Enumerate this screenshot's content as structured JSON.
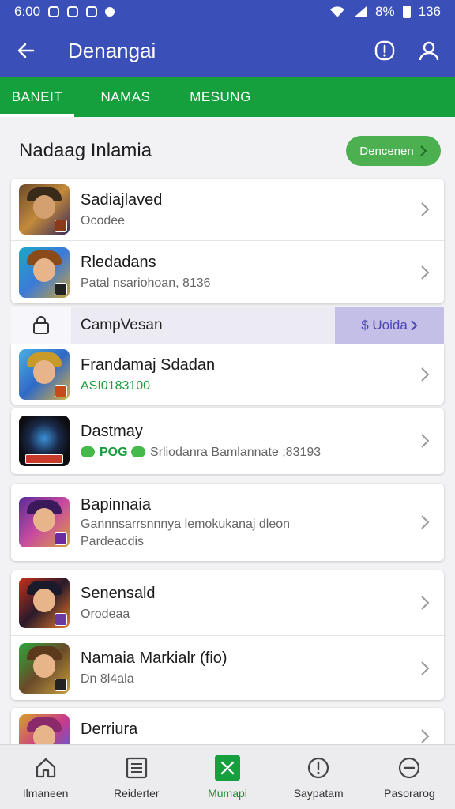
{
  "status": {
    "time": "6:00",
    "battery_text": "8%",
    "right_num": "136"
  },
  "header": {
    "title": "Denangai",
    "back_icon": "back-arrow-icon",
    "info_icon": "alert-icon",
    "profile_icon": "profile-icon"
  },
  "tabs": [
    {
      "label": "BANEIT",
      "active": true
    },
    {
      "label": "NAMAS",
      "active": false
    },
    {
      "label": "MESUNG",
      "active": false
    }
  ],
  "section": {
    "title": "Nadaag Inlamia",
    "button": "Dencenen"
  },
  "card1": [
    {
      "name": "Sadiajlaved",
      "sub": "Ocodee"
    },
    {
      "name": "Rledadans",
      "sub": "Patal nsariohoan, 8136"
    }
  ],
  "promo": {
    "label": "CampVesan",
    "price": "$ Uoida"
  },
  "card2": [
    {
      "name": "Frandamaj Sdadan",
      "sub": "ASI0183100"
    }
  ],
  "card3": [
    {
      "name": "Dastmay",
      "sub": "Srliodanra Bamlannate ;83193",
      "prefix": "POG"
    }
  ],
  "card4": [
    {
      "name": "Bapinnaia",
      "sub": "Gannnsarrsnnnya lemokukanaj dleon",
      "sub2": "Pardeacdis"
    }
  ],
  "card5": [
    {
      "name": "Senensald",
      "sub": "Orodeaa"
    },
    {
      "name": "Namaia Markialr (fio)",
      "sub": "Dn 8l4ala"
    }
  ],
  "card6": [
    {
      "name": "Derriura"
    }
  ],
  "bottom_nav": [
    {
      "label": "Ilmaneen",
      "icon": "home-icon",
      "active": false
    },
    {
      "label": "Reiderter",
      "icon": "list-icon",
      "active": false
    },
    {
      "label": "Mumapi",
      "icon": "map-icon",
      "active": true
    },
    {
      "label": "Saypatam",
      "icon": "alert-circle-icon",
      "active": false
    },
    {
      "label": "Pasorarog",
      "icon": "minus-circle-icon",
      "active": false
    }
  ],
  "colors": {
    "primary": "#3a50b8",
    "tabs": "#159f3d",
    "accent_green": "#4caf50",
    "promo_price": "#4b45b6"
  }
}
